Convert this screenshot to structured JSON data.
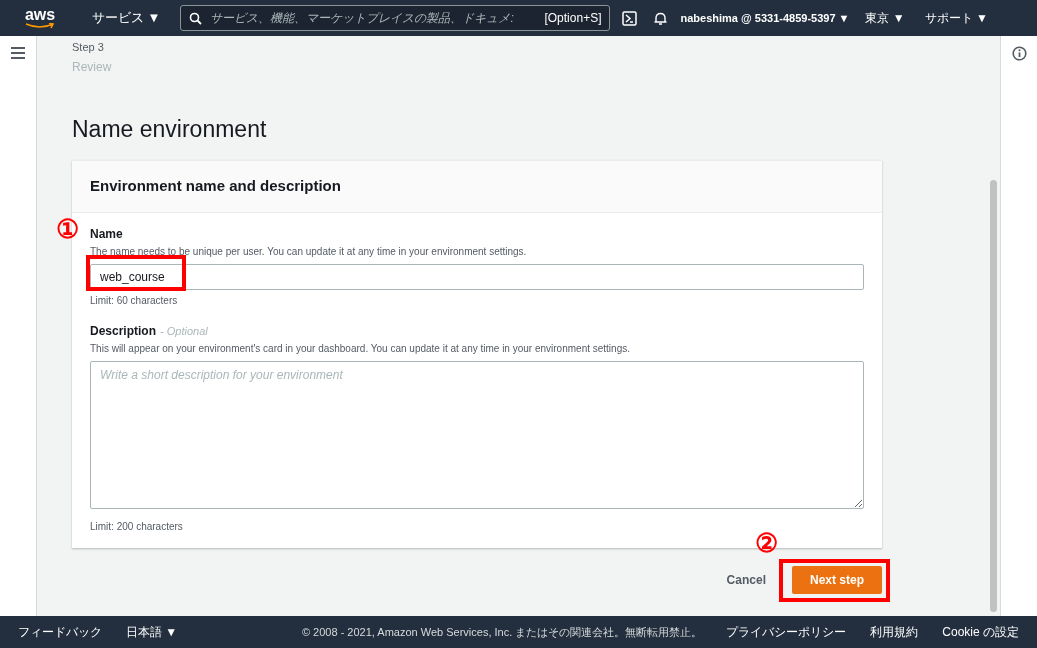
{
  "header": {
    "logo": "aws",
    "services_menu": "サービス ▼",
    "search": {
      "placeholder": "サービス、機能、マーケットプレイスの製品、ドキュメ:",
      "shortcut": "[Option+S]"
    },
    "account_menu": "nabeshima @ 5331-4859-5397 ▼",
    "region_menu": "東京 ▼",
    "support_menu": "サポート ▼"
  },
  "wizard": {
    "step_label": "Step 3",
    "step_name": "Review"
  },
  "page_title": "Name environment",
  "card": {
    "title": "Environment name and description",
    "fields": [
      {
        "kind": "input",
        "label": "Name",
        "hint": "The name needs to be unique per user. You can update it at any time in your environment settings.",
        "value": "web_course",
        "constraint": "Limit: 60 characters"
      },
      {
        "kind": "textarea",
        "label": "Description",
        "optional": "- Optional",
        "hint": "This will appear on your environment's card in your dashboard. You can update it at any time in your environment settings.",
        "placeholder": "Write a short description for your environment",
        "constraint": "Limit: 200 characters"
      }
    ]
  },
  "actions": {
    "cancel": "Cancel",
    "next": "Next step"
  },
  "annotations": [
    {
      "kind": "name-field",
      "number": "①"
    },
    {
      "kind": "next-button",
      "number": "②"
    }
  ],
  "footer": {
    "feedback": "フィードバック",
    "language": "日本語 ▼",
    "copyright": "© 2008 - 2021, Amazon Web Services, Inc. またはその関連会社。無断転用禁止。",
    "links": [
      "プライバシーポリシー",
      "利用規約",
      "Cookie の設定"
    ]
  }
}
